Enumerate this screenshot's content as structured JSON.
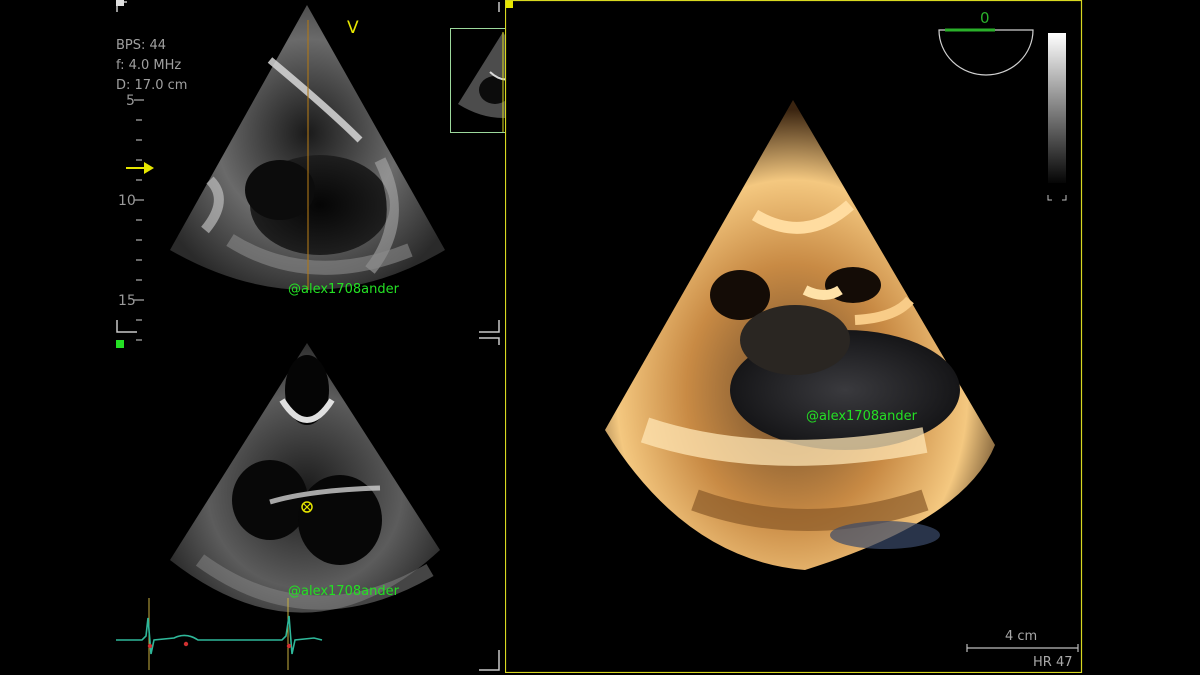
{
  "acquisition": {
    "bps": "BPS: 44",
    "frequency": "f: 4.0 MHz",
    "depth": "D: 17.0 cm"
  },
  "depth_scale": {
    "labels": [
      "5",
      "10",
      "15"
    ]
  },
  "plane_marker": "V",
  "watermarks": {
    "top_2d": "@alex1708ander",
    "bottom_2d": "@alex1708ander",
    "volume_3d": "@alex1708ander"
  },
  "volume_view": {
    "rotation_angle": "0",
    "scale_bar_label": "4 cm",
    "heart_rate": "HR 47"
  },
  "colors": {
    "watermark_green": "#24e024",
    "frame_yellow": "#d8d820",
    "ecg_trace": "#2fb89a",
    "marker_yellow": "#e6e600"
  },
  "icons": [
    "arrow-right-icon",
    "marker-circle-icon",
    "orientation-dial-icon",
    "grayscale-bar-icon"
  ]
}
